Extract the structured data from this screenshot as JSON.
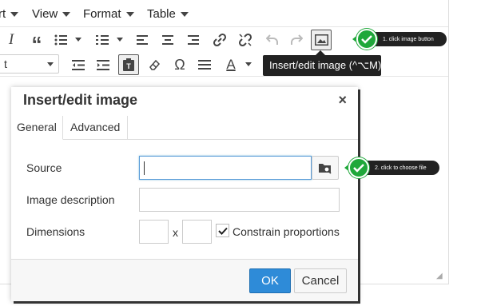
{
  "menubar": {
    "insert_partial": "rt",
    "view": "View",
    "format": "Format",
    "table": "Table"
  },
  "toolbar": {
    "format_select_value": "t",
    "special_char_glyph": "Ω",
    "text_color_glyph": "A",
    "italic_glyph": "I",
    "blockquote_glyph": "“"
  },
  "tooltip": {
    "text": "Insert/edit image (^⌥M)"
  },
  "callouts": {
    "step1": "1. click image button",
    "step2": "2. click to choose file"
  },
  "dialog": {
    "title": "Insert/edit image",
    "close_glyph": "×",
    "tabs": [
      {
        "label": "General"
      },
      {
        "label": "Advanced"
      }
    ],
    "fields": {
      "source_label": "Source",
      "source_value": "",
      "description_label": "Image description",
      "description_value": "",
      "dimensions_label": "Dimensions",
      "width_value": "",
      "height_value": "",
      "dimension_separator": "x",
      "constrain_label": "Constrain proportions",
      "constrain_checked": true
    },
    "buttons": {
      "ok": "OK",
      "cancel": "Cancel"
    }
  },
  "colors": {
    "primary_button": "#2e8bd8",
    "callout_green": "#1fa83a",
    "tooltip_bg": "#222222"
  }
}
